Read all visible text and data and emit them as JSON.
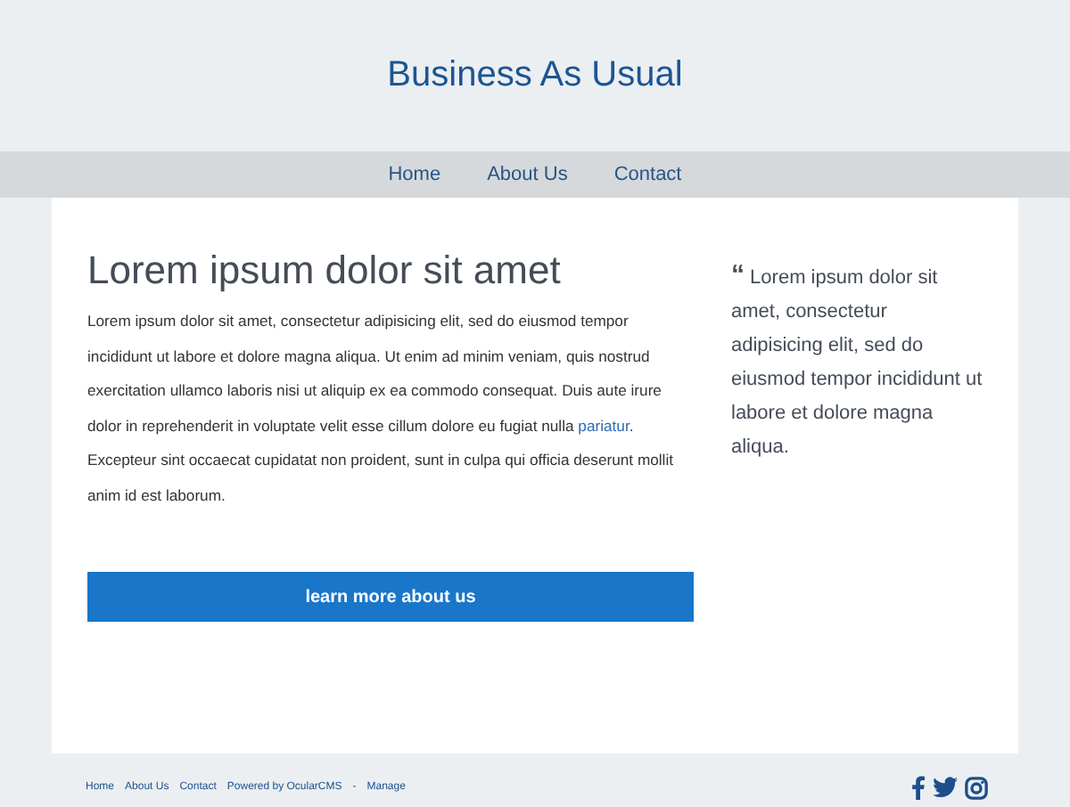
{
  "site_title": "Business As Usual",
  "nav": [
    {
      "label": "Home"
    },
    {
      "label": "About Us"
    },
    {
      "label": "Contact"
    }
  ],
  "main": {
    "heading": "Lorem ipsum dolor sit amet",
    "paragraph": {
      "before": "Lorem ipsum dolor sit amet, consectetur adipisicing elit, sed do eiusmod tempor incididunt ut labore et dolore magna aliqua. Ut enim ad minim veniam, quis nostrud exercitation ullamco laboris nisi ut aliquip ex ea commodo consequat. Duis aute irure dolor in reprehenderit in voluptate velit esse cillum dolore eu fugiat nulla ",
      "link": "pariatur",
      "after": ". Excepteur sint occaecat cupidatat non proident, sunt in culpa qui officia deserunt mollit anim id est laborum."
    },
    "button": "learn more about us"
  },
  "quote": {
    "mark": "“",
    "text": "Lorem ipsum dolor sit amet, consectetur adipisicing elit, sed do eiusmod tempor incididunt ut labore et dolore magna aliqua."
  },
  "footer": {
    "links": [
      {
        "label": "Home"
      },
      {
        "label": "About Us"
      },
      {
        "label": "Contact"
      },
      {
        "label": "Powered by OcularCMS"
      }
    ],
    "separator": "-",
    "manage": "Manage"
  }
}
